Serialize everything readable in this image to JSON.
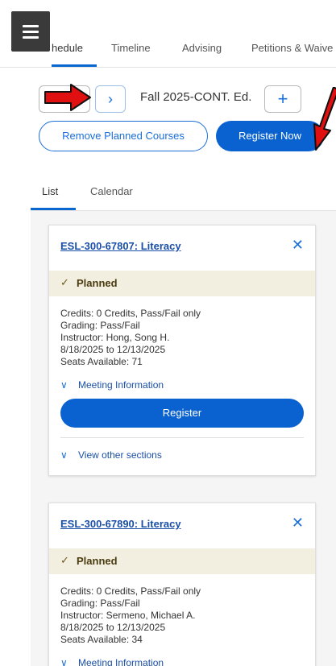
{
  "top_tabs": [
    {
      "label": "hedule"
    },
    {
      "label": "Timeline"
    },
    {
      "label": "Advising"
    },
    {
      "label": "Petitions & Waive"
    }
  ],
  "term": {
    "label": "Fall 2025-CONT. Ed.",
    "next_icon": "chevron-right-icon",
    "add_icon": "plus-icon"
  },
  "actions": {
    "remove_planned": "Remove Planned Courses",
    "register_now": "Register Now"
  },
  "view_tabs": [
    {
      "label": "List"
    },
    {
      "label": "Calendar"
    }
  ],
  "courses": [
    {
      "title": "ESL-300-67807: Literacy",
      "status": "Planned",
      "credits": "Credits: 0 Credits, Pass/Fail only",
      "grading": "Grading: Pass/Fail",
      "instructor": "Instructor: Hong, Song H.",
      "dates": "8/18/2025 to 12/13/2025",
      "seats": "Seats Available:  71",
      "meeting_info": "Meeting Information",
      "register": "Register",
      "other_sections": "View other sections"
    },
    {
      "title": "ESL-300-67890: Literacy",
      "status": "Planned",
      "credits": "Credits: 0 Credits, Pass/Fail only",
      "grading": "Grading: Pass/Fail",
      "instructor": "Instructor: Sermeno, Michael A.",
      "dates": "8/18/2025 to 12/13/2025",
      "seats": "Seats Available:  34",
      "meeting_info": "Meeting Information"
    }
  ],
  "colors": {
    "accent": "#0a62d0",
    "planned_bg": "#f2efe1",
    "annotation_arrow": "#e01010"
  }
}
